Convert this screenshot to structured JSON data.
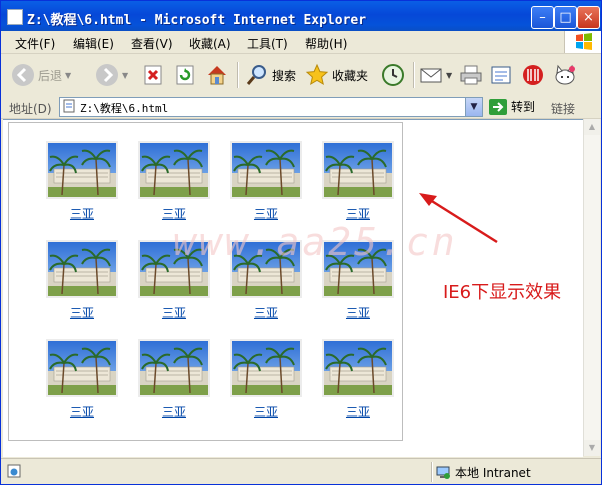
{
  "window": {
    "title": "Z:\\教程\\6.html - Microsoft Internet Explorer"
  },
  "menu": [
    "文件(F)",
    "编辑(E)",
    "查看(V)",
    "收藏(A)",
    "工具(T)",
    "帮助(H)"
  ],
  "toolbar": {
    "back": "后退",
    "search": "搜索",
    "favorites": "收藏夹"
  },
  "address": {
    "label": "地址(D)",
    "value": "Z:\\教程\\6.html",
    "go": "转到",
    "links": "链接"
  },
  "gallery": {
    "items": [
      "三亚",
      "三亚",
      "三亚",
      "三亚",
      "三亚",
      "三亚",
      "三亚",
      "三亚",
      "三亚",
      "三亚",
      "三亚",
      "三亚"
    ]
  },
  "annotation": "IE6下显示效果",
  "watermark": "www.aa25.cn",
  "status": {
    "zone": "本地 Intranet"
  },
  "colors": {
    "title_blue": "#0648d8",
    "link_blue": "#0046a8",
    "annotation_red": "#d81b1b"
  }
}
